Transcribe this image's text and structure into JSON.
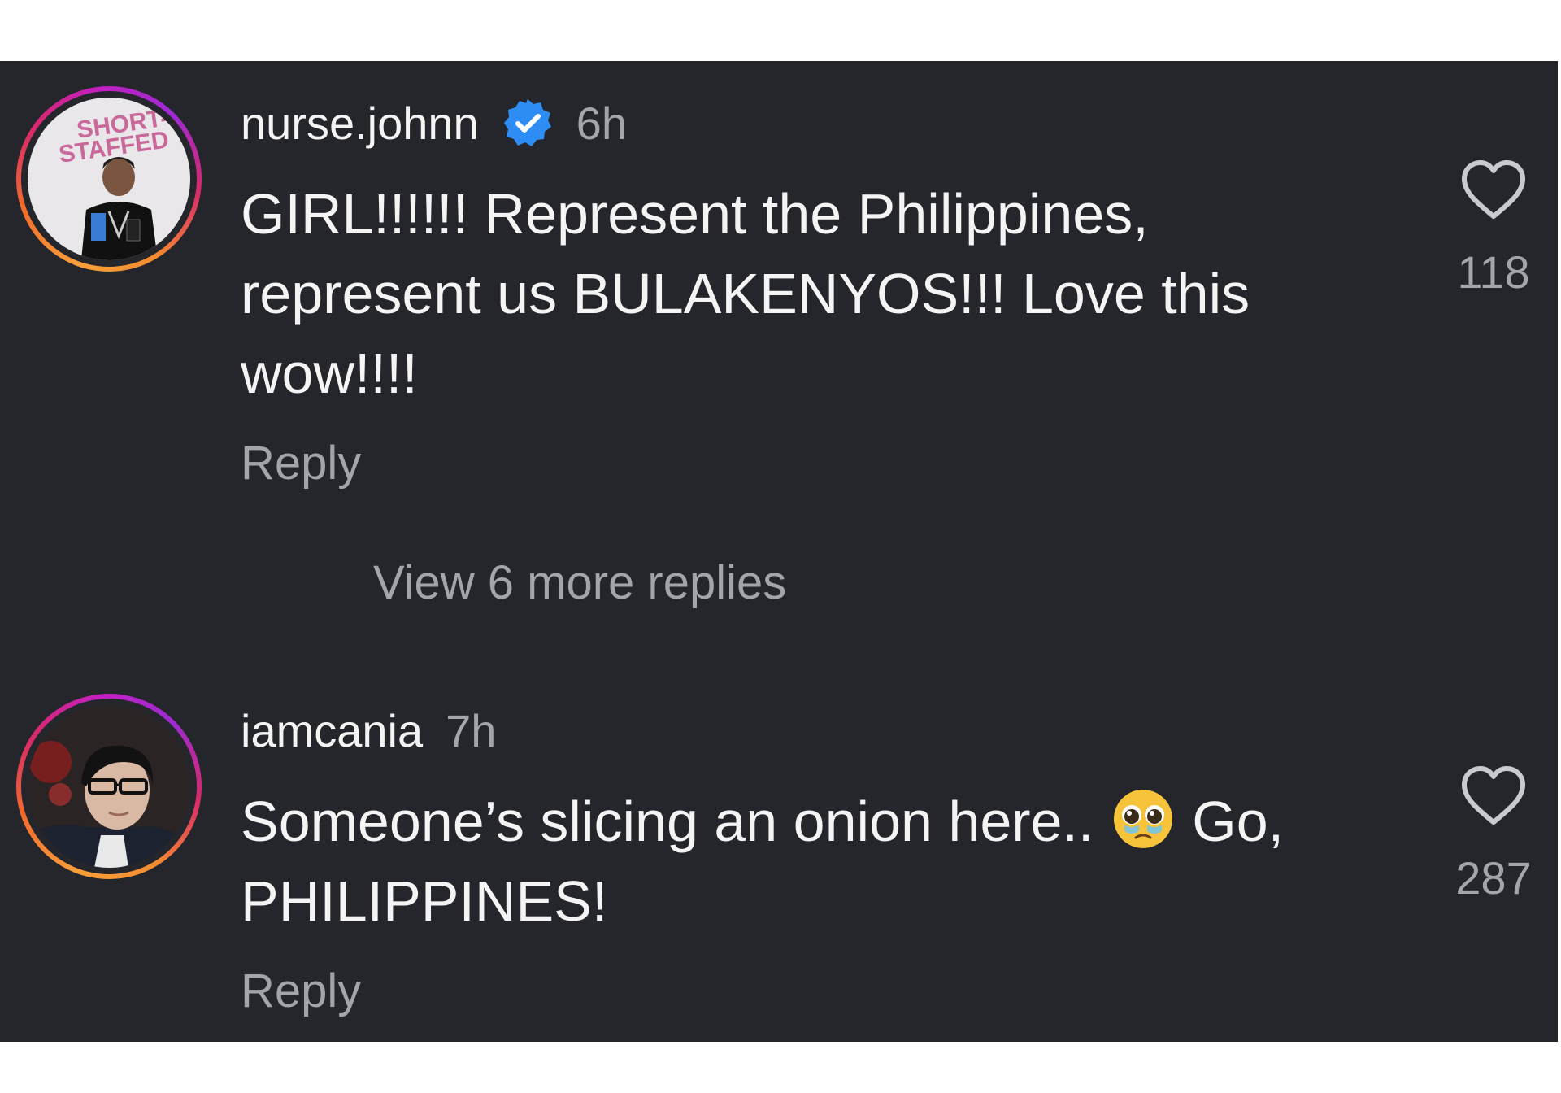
{
  "comments": [
    {
      "username": "nurse.johnn",
      "verified": true,
      "time": "6h",
      "text": "GIRL!!!!!! Represent the Philippines,\nrepresent us BULAKENYOS!!! Love this\nwow!!!!",
      "reply_label": "Reply",
      "like_count": "118",
      "avatar_badge_text": "SHORT-STAFFED"
    },
    {
      "username": "iamcania",
      "verified": false,
      "time": "7h",
      "text_before_emoji": "Someone’s slicing an onion here.. ",
      "emoji": "pleading-face-emoji",
      "text_after_emoji": " Go,\nPHILIPPINES!",
      "reply_label": "Reply",
      "like_count": "287"
    }
  ],
  "view_more_replies": "View 6 more replies",
  "colors": {
    "background": "#25262b",
    "text_primary": "#f4f4f5",
    "text_secondary": "#a3a5ab",
    "verified_blue": "#2e8df5"
  },
  "icons": {
    "like": "heart-outline-icon",
    "verified": "verified-badge-icon"
  }
}
